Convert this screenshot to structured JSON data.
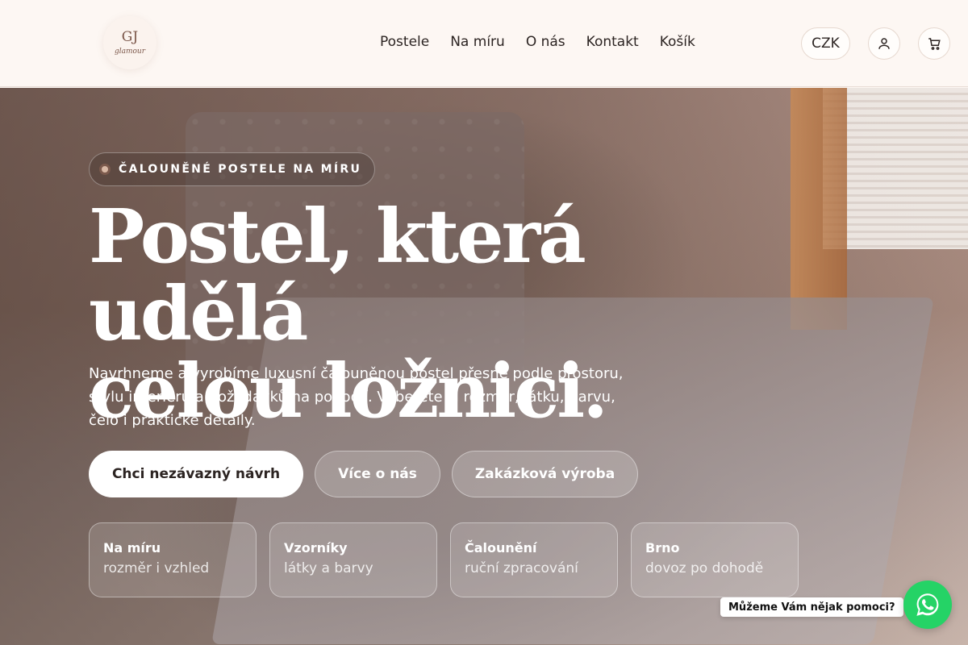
{
  "brand": {
    "mark": "GJ",
    "name": "glamour"
  },
  "nav": {
    "items": [
      "Postele",
      "Na míru",
      "O nás",
      "Kontakt",
      "Košík"
    ]
  },
  "header": {
    "currency": "CZK",
    "user_icon": "user-icon",
    "cart_icon": "cart-icon"
  },
  "hero": {
    "eyebrow": "ČALOUNĚNÉ POSTELE NA MÍRU",
    "headline_line1": "Postel, která udělá",
    "headline_line2": "celou ložnici.",
    "lede": "Navrhneme a vyrobíme luxusní čalouněnou postel přesně podle prostoru, stylu interiéru a požadavků na pohodlí. Vyberete si rozměr, látku, barvu, čelo i praktické detaily.",
    "cta_primary": "Chci nezávazný návrh",
    "cta_about": "Více o nás",
    "cta_custom": "Zakázková výroba",
    "features": [
      {
        "title": "Na míru",
        "sub": "rozměr i vzhled"
      },
      {
        "title": "Vzorníky",
        "sub": "látky a barvy"
      },
      {
        "title": "Čalounění",
        "sub": "ruční zpracování"
      },
      {
        "title": "Brno",
        "sub": "dovoz po dohodě"
      }
    ]
  },
  "chat": {
    "bubble": "Můžeme Vám nějak pomoci?",
    "icon": "whatsapp-icon",
    "color": "#25d366"
  }
}
